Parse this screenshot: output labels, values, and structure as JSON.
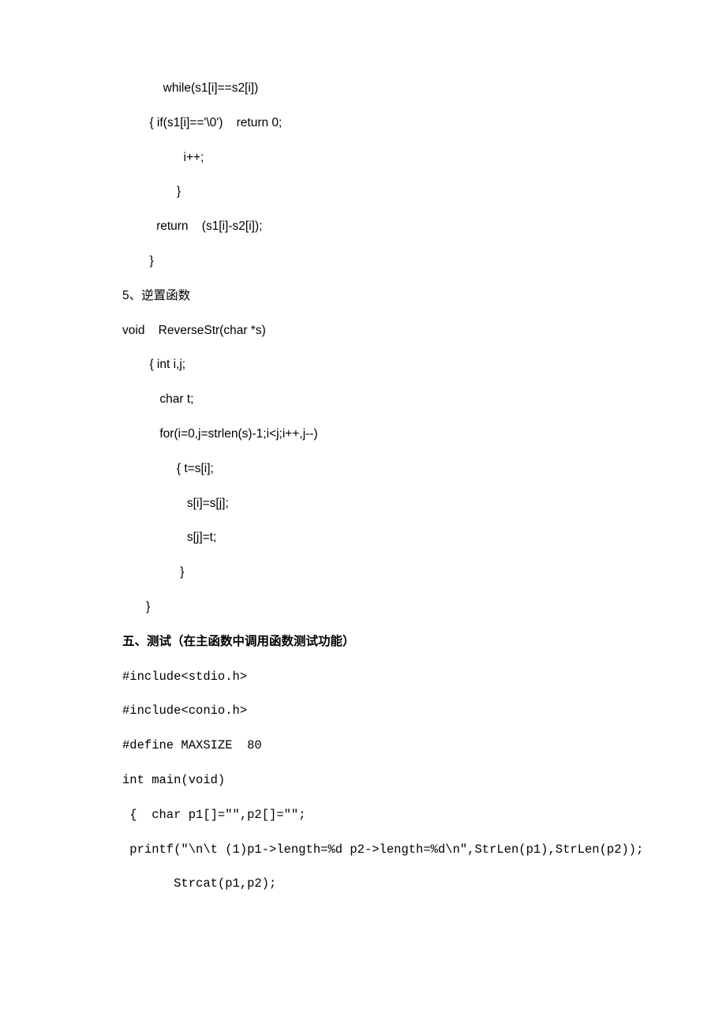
{
  "code": {
    "l1": "            while(s1[i]==s2[i])",
    "l2": "        { if(s1[i]=='\\0')    return 0;",
    "l3": "                  i++;",
    "l4": "                }",
    "l5": "          return    (s1[i]-s2[i]);",
    "l6": "        }",
    "sec5": "5、逆置函数",
    "l7": "void    ReverseStr(char *s)",
    "l8": "        { int i,j;",
    "l9": "           char t;",
    "l10": "           for(i=0,j=strlen(s)-1;i<j;i++,j--)",
    "l11": "                { t=s[i];",
    "l12": "                   s[i]=s[j];",
    "l13": "                   s[j]=t;",
    "l14": "                 }",
    "l15": "       }"
  },
  "test": {
    "heading": "五、测试（在主函数中调用函数测试功能）",
    "m1": "#include<stdio.h>",
    "m2": "#include<conio.h>",
    "m3": "#define MAXSIZE  80",
    "m4": "int main(void)",
    "m5": " {  char p1[]=\"\",p2[]=\"\";",
    "m6": " printf(\"\\n\\t (1)p1->length=%d p2->length=%d\\n\",StrLen(p1),StrLen(p2));",
    "m7": "       Strcat(p1,p2);"
  }
}
